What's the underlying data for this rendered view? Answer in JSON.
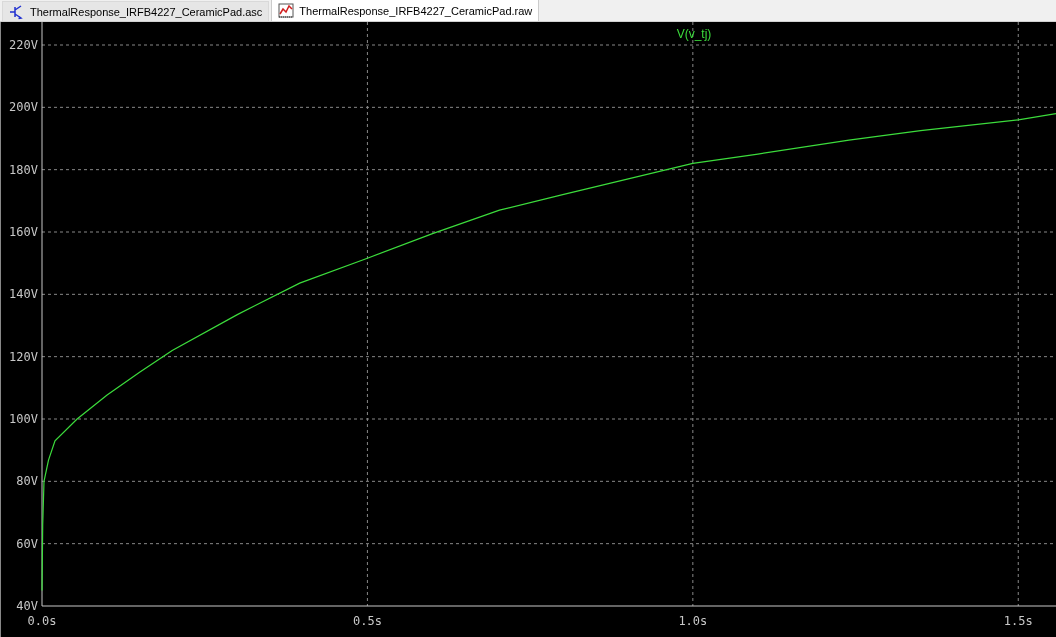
{
  "tabs": [
    {
      "label": "ThermalResponse_IRFB4227_CeramicPad.asc",
      "kind": "schematic",
      "selected": false
    },
    {
      "label": "ThermalResponse_IRFB4227_CeramicPad.raw",
      "kind": "waveform",
      "selected": true
    }
  ],
  "plot": {
    "chart_data": {
      "type": "line",
      "grid": true,
      "x": [
        0,
        0.001,
        0.003,
        0.01,
        0.02,
        0.054,
        0.1,
        0.15,
        0.2,
        0.3,
        0.396,
        0.5,
        0.6,
        0.703,
        0.8,
        1.0,
        1.1,
        1.24,
        1.35,
        1.5,
        1.558
      ],
      "series": [
        {
          "name": "V(v_tj)",
          "color": "#3cdc3c",
          "values": [
            45,
            66,
            80,
            86.8,
            93,
            100,
            107.7,
            115,
            122,
            133.5,
            143.6,
            151.6,
            159.5,
            167,
            172,
            182,
            185,
            189.5,
            192.5,
            196,
            198
          ]
        }
      ],
      "xlim": [
        0,
        1.558
      ],
      "ylim": [
        40,
        220
      ],
      "xticks": [
        {
          "value": 0,
          "label": "0.0s"
        },
        {
          "value": 0.5,
          "label": "0.5s"
        },
        {
          "value": 1.0,
          "label": "1.0s"
        },
        {
          "value": 1.5,
          "label": "1.5s"
        }
      ],
      "yticks": [
        {
          "value": 40,
          "label": "40V"
        },
        {
          "value": 60,
          "label": "60V"
        },
        {
          "value": 80,
          "label": "80V"
        },
        {
          "value": 100,
          "label": "100V"
        },
        {
          "value": 120,
          "label": "120V"
        },
        {
          "value": 140,
          "label": "140V"
        },
        {
          "value": 160,
          "label": "160V"
        },
        {
          "value": 180,
          "label": "180V"
        },
        {
          "value": 200,
          "label": "200V"
        },
        {
          "value": 220,
          "label": "220V"
        }
      ]
    }
  }
}
